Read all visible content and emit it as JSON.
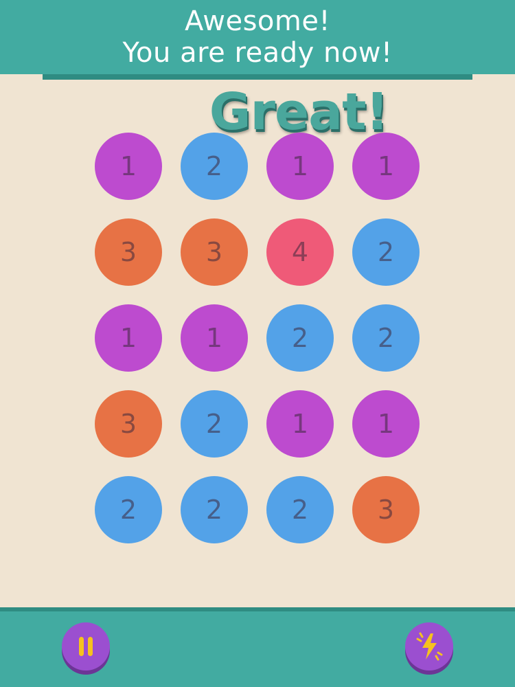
{
  "header": {
    "line1": "Awesome!",
    "line2": "You are ready now!"
  },
  "banner": "Great!",
  "colors": {
    "purple": "#bd4bcf",
    "blue": "#53a2e8",
    "orange": "#e77245",
    "pink": "#ef5a78",
    "teal": "#42aba1",
    "background": "#f0e4d2",
    "button": "#9b4fd0",
    "button_icon": "#f6c21e"
  },
  "grid": {
    "rows": [
      [
        {
          "value": "1",
          "color": "purple"
        },
        {
          "value": "2",
          "color": "blue"
        },
        {
          "value": "1",
          "color": "purple"
        },
        {
          "value": "1",
          "color": "purple"
        }
      ],
      [
        {
          "value": "3",
          "color": "orange"
        },
        {
          "value": "3",
          "color": "orange"
        },
        {
          "value": "4",
          "color": "pink"
        },
        {
          "value": "2",
          "color": "blue"
        }
      ],
      [
        {
          "value": "1",
          "color": "purple"
        },
        {
          "value": "1",
          "color": "purple"
        },
        {
          "value": "2",
          "color": "blue"
        },
        {
          "value": "2",
          "color": "blue"
        }
      ],
      [
        {
          "value": "3",
          "color": "orange"
        },
        {
          "value": "2",
          "color": "blue"
        },
        {
          "value": "1",
          "color": "purple"
        },
        {
          "value": "1",
          "color": "purple"
        }
      ],
      [
        {
          "value": "2",
          "color": "blue"
        },
        {
          "value": "2",
          "color": "blue"
        },
        {
          "value": "2",
          "color": "blue"
        },
        {
          "value": "3",
          "color": "orange"
        }
      ]
    ]
  },
  "footer": {
    "pause_icon": "pause-icon",
    "power_icon": "lightning-icon"
  }
}
